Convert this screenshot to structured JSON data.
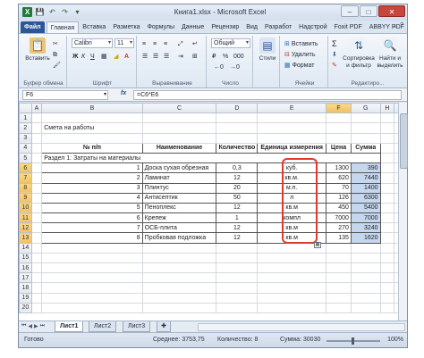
{
  "window": {
    "title": "Книга1.xlsx - Microsoft Excel",
    "quick_access": [
      "X",
      "💾",
      "↶",
      "↷",
      "▾"
    ],
    "controls": {
      "minimize": "–",
      "maximize": "□",
      "close": "✕"
    }
  },
  "ribbon_tabs": [
    {
      "label": "Файл",
      "kind": "file"
    },
    {
      "label": "Главная",
      "kind": "active"
    },
    {
      "label": "Вставка"
    },
    {
      "label": "Разметка"
    },
    {
      "label": "Формулы"
    },
    {
      "label": "Данные"
    },
    {
      "label": "Рецензир"
    },
    {
      "label": "Вид"
    },
    {
      "label": "Разработ"
    },
    {
      "label": "Надстрой"
    },
    {
      "label": "Foxit PDF"
    },
    {
      "label": "ABBYY PDF"
    }
  ],
  "ribbon": {
    "clipboard": {
      "paste": "Вставить",
      "group": "Буфер обмена"
    },
    "font": {
      "name": "Calibri",
      "size": "11",
      "bold": "Ж",
      "italic": "К",
      "underline": "Ч",
      "group": "Шрифт"
    },
    "alignment": {
      "group": "Выравнивание"
    },
    "number": {
      "format": "Общий",
      "group": "Число"
    },
    "styles": {
      "label": "Стили"
    },
    "cells": {
      "insert": "Вставить",
      "delete": "Удалить",
      "format": "Формат",
      "group": "Ячейки"
    },
    "editing": {
      "sort": "Сортировка и фильтр",
      "find": "Найти и выделить",
      "sigma": "Σ",
      "group": "Редактиро..."
    }
  },
  "formula_bar": {
    "name_box": "F6",
    "fx": "fx",
    "formula": "=C6*E6"
  },
  "columns": [
    "A",
    "B",
    "C",
    "D",
    "E",
    "F",
    "G",
    "H",
    "I"
  ],
  "sheet": {
    "title": "Смета на работы",
    "headers": {
      "n": "№ п/п",
      "name": "Наименование",
      "qty": "Количество",
      "unit": "Единица измерения",
      "price": "Цена",
      "sum": "Сумма"
    },
    "section": "Раздел 1: Затраты на материалы",
    "rows": [
      {
        "row": "6",
        "n": "1",
        "name": "Доска сухая обрезная",
        "qty": "0,3",
        "unit": "куб.",
        "price": "1300",
        "sum": "390"
      },
      {
        "row": "7",
        "n": "2",
        "name": "Ламинат",
        "qty": "12",
        "unit": "кв.м.",
        "price": "620",
        "sum": "7440"
      },
      {
        "row": "8",
        "n": "3",
        "name": "Плинтус",
        "qty": "20",
        "unit": "м.п.",
        "price": "70",
        "sum": "1400"
      },
      {
        "row": "9",
        "n": "4",
        "name": "Антисептик",
        "qty": "50",
        "unit": "л",
        "price": "126",
        "sum": "6300"
      },
      {
        "row": "10",
        "n": "5",
        "name": "Пеноплекс",
        "qty": "12",
        "unit": "кв.м",
        "price": "450",
        "sum": "5400"
      },
      {
        "row": "11",
        "n": "6",
        "name": "Крепеж",
        "qty": "1",
        "unit": "компл",
        "price": "7000",
        "sum": "7000"
      },
      {
        "row": "12",
        "n": "7",
        "name": "ОСБ-плита",
        "qty": "12",
        "unit": "кв.м",
        "price": "270",
        "sum": "3240"
      },
      {
        "row": "13",
        "n": "8",
        "name": "Пробковая подложка",
        "qty": "12",
        "unit": "кв.м",
        "price": "135",
        "sum": "1620"
      }
    ]
  },
  "sheet_tabs": [
    "Лист1",
    "Лист2",
    "Лист3"
  ],
  "status": {
    "ready": "Готово",
    "average": "Среднее: 3753,75",
    "count": "Количество: 8",
    "sum": "Сумма: 30030",
    "zoom": "100%"
  }
}
